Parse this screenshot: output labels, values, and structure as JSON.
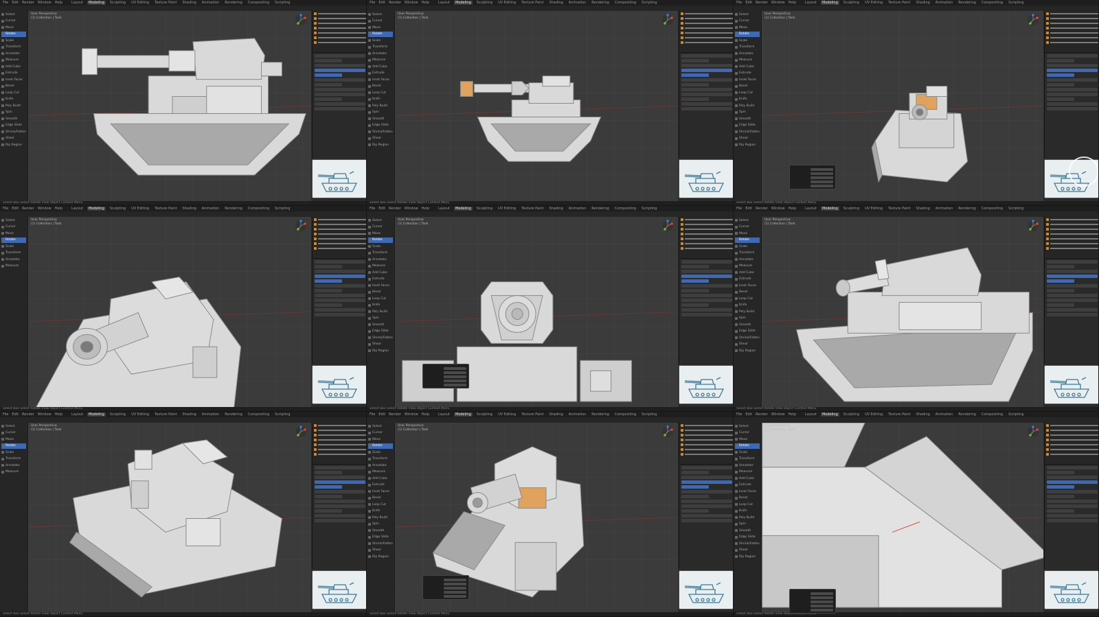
{
  "app": {
    "menu": [
      "File",
      "Edit",
      "Render",
      "Window",
      "Help"
    ],
    "workspaces": [
      "Layout",
      "Modeling",
      "Sculpting",
      "UV Editing",
      "Texture Paint",
      "Shading",
      "Animation",
      "Rendering",
      "Compositing",
      "Scripting"
    ],
    "active_workspace": "Modeling"
  },
  "viewport": {
    "labels": [
      "User Perspective",
      "(1) Collection | Tank"
    ]
  },
  "toolbar": {
    "tools": [
      "Select",
      "Cursor",
      "Move",
      "Rotate",
      "Scale",
      "Transform",
      "Annotate",
      "Measure",
      "Add Cube",
      "Extrude",
      "Inset Faces",
      "Bevel",
      "Loop Cut",
      "Knife",
      "Poly Build",
      "Spin",
      "Smooth",
      "Edge Slide",
      "Shrink/Fatten",
      "Shear",
      "Rip Region"
    ],
    "active_index": 3
  },
  "status": {
    "text": "Select   Box Select   Rotate View   Object Context Menu"
  },
  "colors": {
    "viewport_bg": "#3b3b3b",
    "model_face": "#d9d9d9",
    "model_shade": "#a9a9a9",
    "accent": "#3d69b5",
    "highlight_orange": "#e0a25c"
  },
  "icons": {
    "gizmo": "navigation-gizmo-icon",
    "tool": "tool-icon",
    "outliner_item": "mesh-object-icon"
  }
}
